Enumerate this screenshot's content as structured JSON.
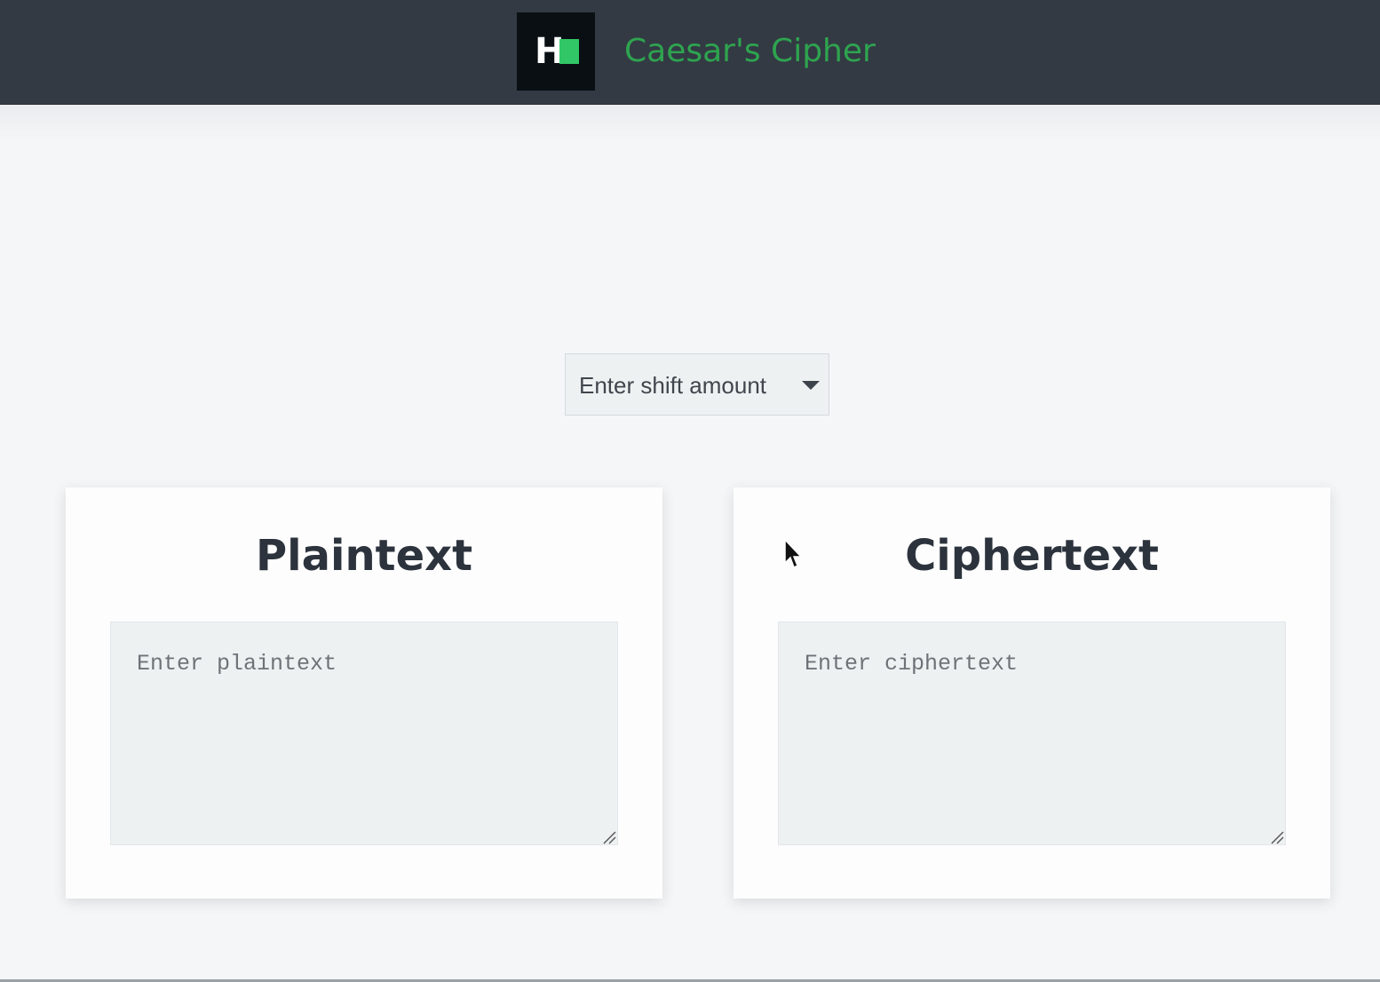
{
  "header": {
    "logo_letter": "H",
    "title": "Caesar's Cipher",
    "brand_color": "#2ea44f",
    "background": "#333a44"
  },
  "shift": {
    "placeholder": "Enter shift amount",
    "icon": "chevron-down-icon"
  },
  "panels": [
    {
      "title": "Plaintext",
      "placeholder": "Enter plaintext",
      "value": ""
    },
    {
      "title": "Ciphertext",
      "placeholder": "Enter ciphertext",
      "value": ""
    }
  ]
}
